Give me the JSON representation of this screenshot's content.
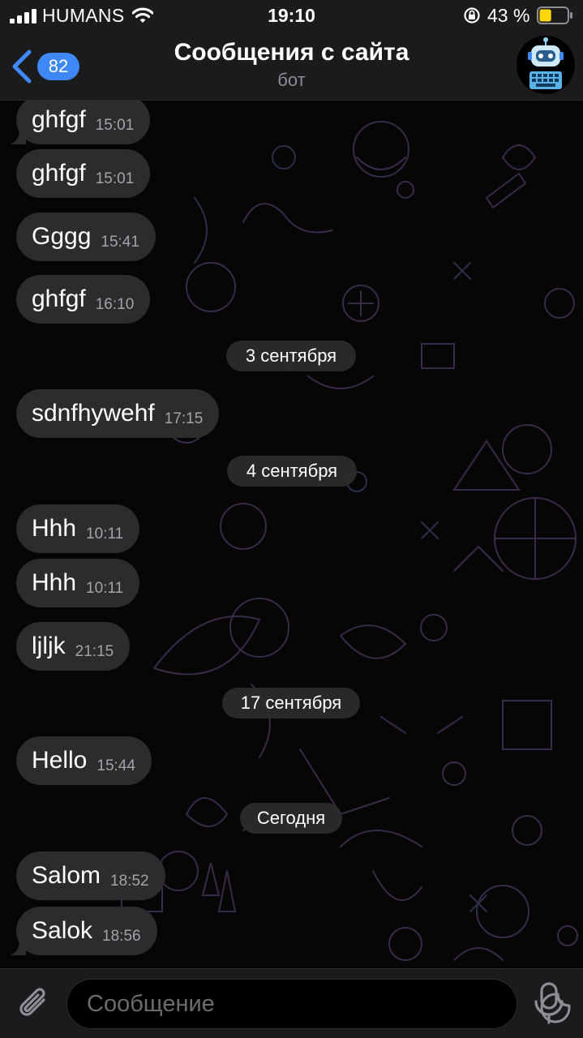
{
  "status_bar": {
    "carrier": "HUMANS",
    "time": "19:10",
    "battery": "43 %",
    "battery_level": 0.43,
    "icons": [
      "signal-icon",
      "wifi-icon",
      "orientation-lock-icon",
      "battery-icon"
    ]
  },
  "header": {
    "back_badge": "82",
    "title": "Сообщения с сайта",
    "subtitle": "бот",
    "avatar_icon": "robot-icon",
    "accent_color": "#3e88f7"
  },
  "messages": [
    {
      "text": "ghfgf",
      "time": "15:01"
    },
    {
      "text": "ghfgf",
      "time": "15:01"
    },
    {
      "text": "Gggg",
      "time": "15:41"
    },
    {
      "text": "ghfgf",
      "time": "16:10"
    },
    {
      "text": "sdnfhywehf",
      "time": "17:15"
    },
    {
      "text": "Hhh",
      "time": "10:11"
    },
    {
      "text": "Hhh",
      "time": "10:11"
    },
    {
      "text": "ljljk",
      "time": "21:15"
    },
    {
      "text": "Hello",
      "time": "15:44"
    },
    {
      "text": "Salom",
      "time": "18:52"
    },
    {
      "text": "Salok",
      "time": "18:56"
    }
  ],
  "date_separators": [
    "3 сентября",
    "4 сентября",
    "17 сентября",
    "Сегодня"
  ],
  "input": {
    "placeholder": "Сообщение",
    "value": "",
    "icons": [
      "paperclip-icon",
      "sticker-icon",
      "microphone-icon"
    ]
  }
}
